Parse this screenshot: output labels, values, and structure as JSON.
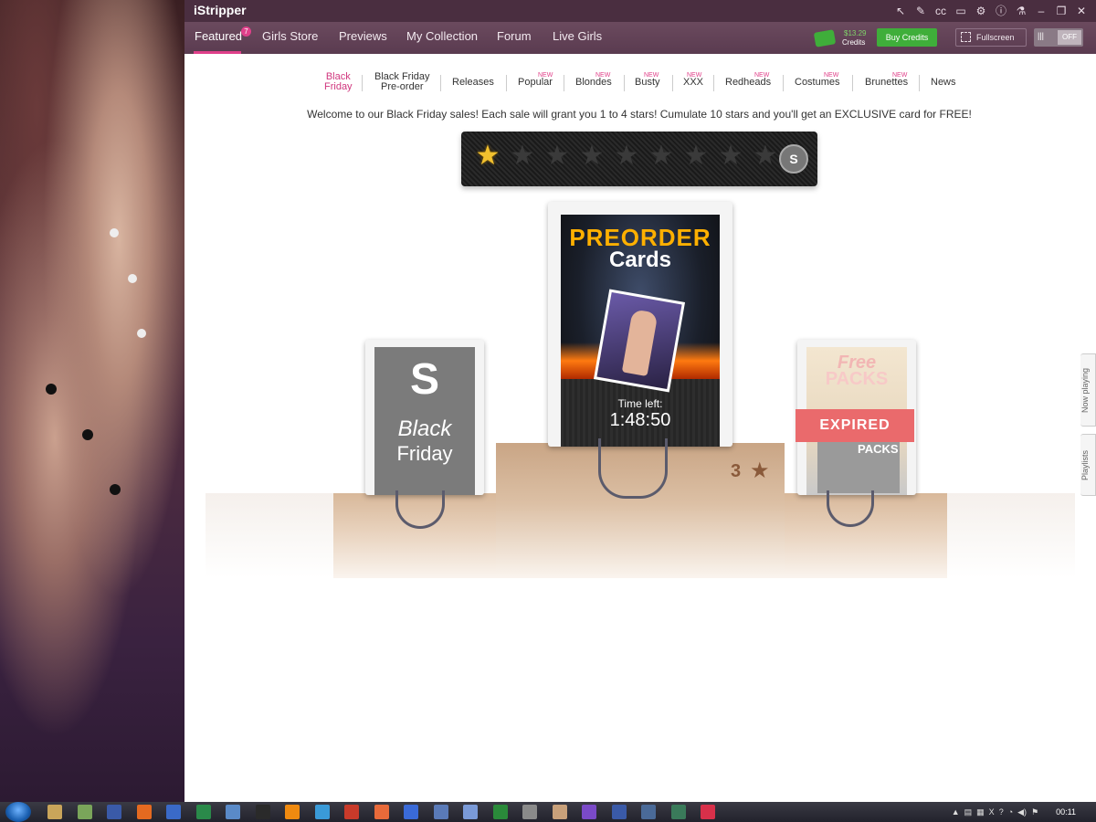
{
  "app": {
    "title": "iStripper",
    "window_tool_icons": [
      "pointer-icon",
      "cursor-icon",
      "cc-icon",
      "monitor-icon",
      "settings-icon",
      "info-icon",
      "flask-icon",
      "minimize-icon",
      "restore-icon",
      "close-icon"
    ]
  },
  "nav": {
    "tabs": [
      {
        "label": "Featured",
        "active": true
      },
      {
        "label": "Girls Store"
      },
      {
        "label": "Previews"
      },
      {
        "label": "My Collection"
      },
      {
        "label": "Forum"
      },
      {
        "label": "Live Girls"
      }
    ],
    "featured_badge": "7",
    "credits_amount": "$13.29",
    "credits_label": "Credits",
    "buy_credits": "Buy Credits",
    "fullscreen": "Fullscreen",
    "toggle_bars": "|||",
    "toggle_off": "OFF"
  },
  "categories": [
    {
      "line1": "Black",
      "line2": "Friday",
      "active": true
    },
    {
      "line1": "Black Friday",
      "line2": "Pre-order"
    },
    {
      "line1": "Releases"
    },
    {
      "line1": "Popular",
      "new": "NEW"
    },
    {
      "line1": "Blondes",
      "new": "NEW"
    },
    {
      "line1": "Busty",
      "new": "NEW"
    },
    {
      "line1": "XXX",
      "new": "NEW"
    },
    {
      "line1": "Redheads",
      "new": "NEW"
    },
    {
      "line1": "Costumes",
      "new": "NEW"
    },
    {
      "line1": "Brunettes",
      "new": "NEW"
    },
    {
      "line1": "News"
    }
  ],
  "welcome": "Welcome to our Black Friday sales! Each sale will grant you 1 to 4 stars! Cumulate 10 stars and you'll get an EXCLUSIVE card for FREE!",
  "stars": {
    "filled": 1,
    "total": 10,
    "card_icon_letter": "S"
  },
  "cards": {
    "black_friday": {
      "logo_letter": "S",
      "title_line1": "Black",
      "title_line2": "Friday"
    },
    "preorder": {
      "title_line1": "PREORDER",
      "title_line2": "Cards",
      "time_left_label": "Time left:",
      "time_left_value": "1:48:50"
    },
    "free_packs": {
      "title_line1": "Free",
      "title_line2": "PACKS",
      "banner": "EXPIRED",
      "box_label": "PACKS"
    },
    "star_reward": "3"
  },
  "side_tabs": {
    "now_playing": "Now playing",
    "playlists": "Playlists"
  },
  "taskbar": {
    "clock": "00:11",
    "tray_icons": [
      "up-arrow-icon",
      "file-icon",
      "network-icon",
      "x-icon",
      "help-icon",
      "wifi-icon",
      "volume-icon",
      "flag-icon"
    ],
    "app_icons": [
      {
        "name": "explorer-icon",
        "color": "#c9a55a"
      },
      {
        "name": "notepad-icon",
        "color": "#7aa55a"
      },
      {
        "name": "save-icon",
        "color": "#3a5aa8"
      },
      {
        "name": "firefox-icon",
        "color": "#e56a20"
      },
      {
        "name": "doc-icon",
        "color": "#3a6ac8"
      },
      {
        "name": "spreadsheet-icon",
        "color": "#2a8a4a"
      },
      {
        "name": "viewer-icon",
        "color": "#5a8ac8"
      },
      {
        "name": "terminal-icon",
        "color": "#2a2a2a"
      },
      {
        "name": "vlc-icon",
        "color": "#f08a10"
      },
      {
        "name": "music-icon",
        "color": "#3a9ad8"
      },
      {
        "name": "filezilla-icon",
        "color": "#c83a2a"
      },
      {
        "name": "tool-icon",
        "color": "#e86a3a"
      },
      {
        "name": "pen-icon",
        "color": "#3a6ad8"
      },
      {
        "name": "window-icon",
        "color": "#5a7ab8"
      },
      {
        "name": "window2-icon",
        "color": "#7a9ad8"
      },
      {
        "name": "network-icon",
        "color": "#2a8a3a"
      },
      {
        "name": "printer-icon",
        "color": "#8a8a8a"
      },
      {
        "name": "hand-icon",
        "color": "#c8a07a"
      },
      {
        "name": "visualstudio-icon",
        "color": "#7a4ac8"
      },
      {
        "name": "gear-icon",
        "color": "#3a5aa8"
      },
      {
        "name": "remote-icon",
        "color": "#4a6a98"
      },
      {
        "name": "media-icon",
        "color": "#3a7a5a"
      },
      {
        "name": "istripper-icon",
        "color": "#d8304a"
      }
    ]
  }
}
